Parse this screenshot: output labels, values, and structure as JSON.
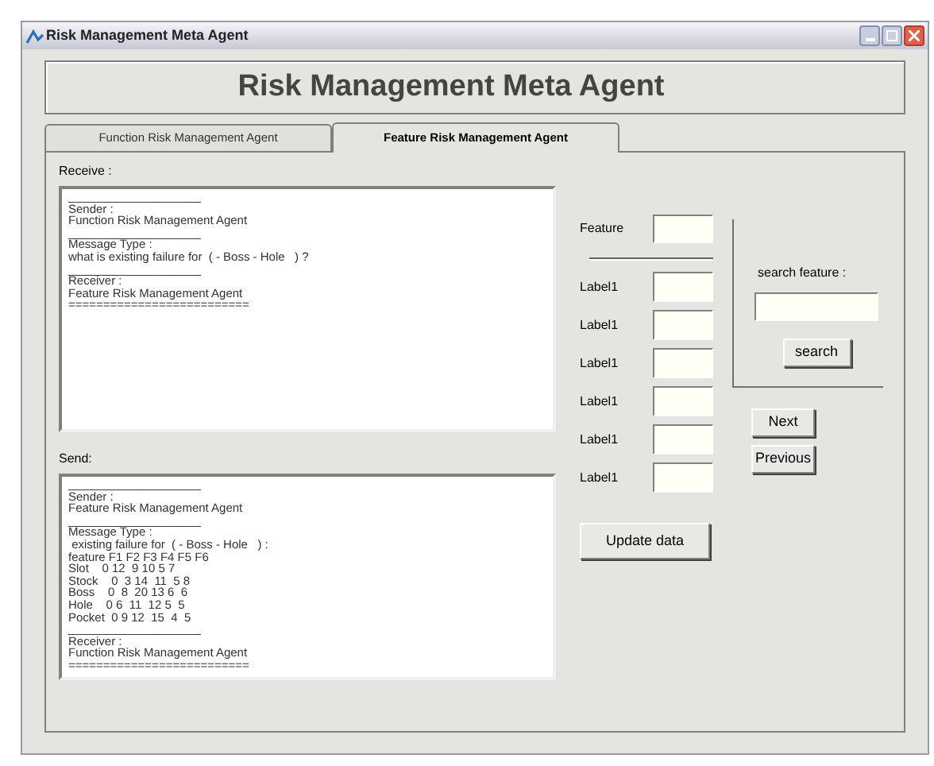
{
  "window": {
    "title": "Risk Management Meta Agent"
  },
  "header": "Risk Management Meta Agent",
  "tabs": [
    {
      "label": "Function Risk Management Agent",
      "selected": false
    },
    {
      "label": "Feature Risk Management Agent",
      "selected": true
    }
  ],
  "receive": {
    "label": "Receive :",
    "lines": [
      "____________________",
      "Sender :",
      "Function Risk Management Agent",
      "____________________",
      "Message Type :",
      "what is existing failure for  ( - Boss - Hole   ) ?",
      "____________________",
      "Receiver :",
      "Feature Risk Management Agent",
      "=========================="
    ]
  },
  "send": {
    "label": "Send:",
    "lines": [
      "____________________",
      "Sender :",
      "Feature Risk Management Agent",
      "____________________",
      "Message Type :",
      " existing failure for  ( - Boss - Hole   ) :",
      "feature F1 F2 F3 F4 F5 F6",
      "Slot    0 12  9 10 5 7",
      "Stock    0  3 14  11  5 8",
      "Boss    0  8  20 13 6  6",
      "Hole    0 6  11  12 5  5",
      "Pocket  0 9 12  15  4  5",
      "____________________",
      "Receiver :",
      "Function Risk Management Agent",
      "=========================="
    ]
  },
  "feature": {
    "label": "Feature"
  },
  "fields": [
    {
      "label": "Label1"
    },
    {
      "label": "Label1"
    },
    {
      "label": "Label1"
    },
    {
      "label": "Label1"
    },
    {
      "label": "Label1"
    },
    {
      "label": "Label1"
    }
  ],
  "update_button": "Update data",
  "search": {
    "label": "search feature :",
    "button": "search"
  },
  "nav_buttons": [
    "Next",
    "Previous"
  ]
}
